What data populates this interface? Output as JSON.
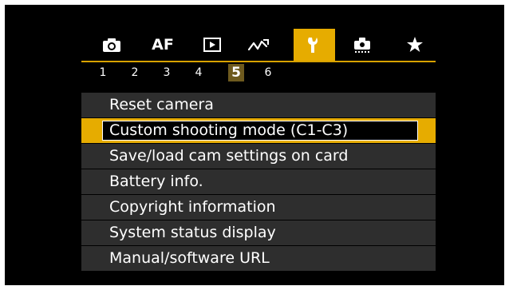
{
  "tabs": [
    {
      "icon": "camera-icon",
      "label": "",
      "active": false
    },
    {
      "icon": "af-icon",
      "label": "AF",
      "active": false
    },
    {
      "icon": "playback-icon",
      "label": "",
      "active": false
    },
    {
      "icon": "wireless-icon",
      "label": "",
      "active": false
    },
    {
      "icon": "wrench-icon",
      "label": "",
      "active": true
    },
    {
      "icon": "custom-functions-icon",
      "label": "",
      "active": false
    },
    {
      "icon": "star-icon",
      "label": "",
      "active": false
    }
  ],
  "pages": [
    "1",
    "2",
    "3",
    "4",
    "5",
    "6"
  ],
  "active_page": "5",
  "menu": {
    "items": [
      "Reset camera",
      "Custom shooting mode (C1-C3)",
      "Save/load cam settings on card",
      "Battery info.",
      "Copyright information",
      "System status display",
      "Manual/software URL"
    ],
    "selected_index": 1
  },
  "colors": {
    "accent": "#e6ac00",
    "active_page_bg": "#6e5a1e",
    "item_bg": "#2e2e2e",
    "screen_bg": "#000000"
  }
}
